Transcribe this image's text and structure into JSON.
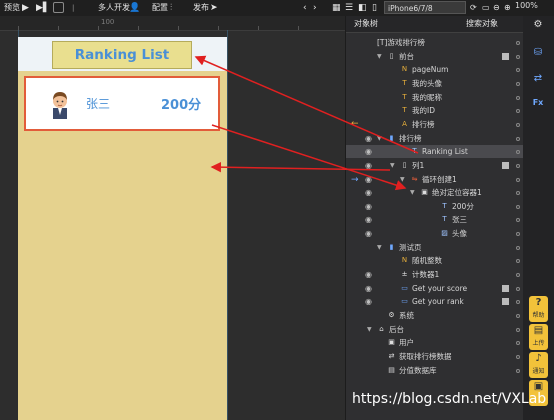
{
  "toolbar": {
    "preview": "预览",
    "multiplayer": "多人开发",
    "config": "配置",
    "publish": "发布",
    "device": "iPhone6/7/8 375*667",
    "zoom": "100%"
  },
  "ruler": {
    "label": "100"
  },
  "phone": {
    "title": "Ranking List",
    "row_name": "张三",
    "row_score": "200分"
  },
  "panel": {
    "tab_objects": "对象树",
    "tab_search": "搜索对象"
  },
  "tree": [
    {
      "label": "[T]游戏排行榜"
    },
    {
      "label": "前台"
    },
    {
      "label": "pageNum"
    },
    {
      "label": "我的头像"
    },
    {
      "label": "我的昵称"
    },
    {
      "label": "我的ID"
    },
    {
      "label": "排行榜"
    },
    {
      "label": "排行榜"
    },
    {
      "label": "Ranking List"
    },
    {
      "label": "列1"
    },
    {
      "label": "循环创建1"
    },
    {
      "label": "绝对定位容器1"
    },
    {
      "label": "200分"
    },
    {
      "label": "张三"
    },
    {
      "label": "头像"
    },
    {
      "label": "测试页"
    },
    {
      "label": "随机整数"
    },
    {
      "label": "计数器1"
    },
    {
      "label": "Get your score"
    },
    {
      "label": "Get your rank"
    },
    {
      "label": "系统"
    },
    {
      "label": "后台"
    },
    {
      "label": "用户"
    },
    {
      "label": "获取排行榜数据"
    },
    {
      "label": "分值数据库"
    }
  ],
  "rightbar": {
    "help": "帮助",
    "upload": "上传",
    "notify": "通知"
  },
  "watermark": "https://blog.csdn.net/VXLab",
  "colors": {
    "phone_bg": "#e5d28e",
    "title_bg": "#e9df8f",
    "accent_blue": "#4a90d6",
    "highlight_red": "#e25c3a",
    "annotation_arrow": "#e02020"
  }
}
